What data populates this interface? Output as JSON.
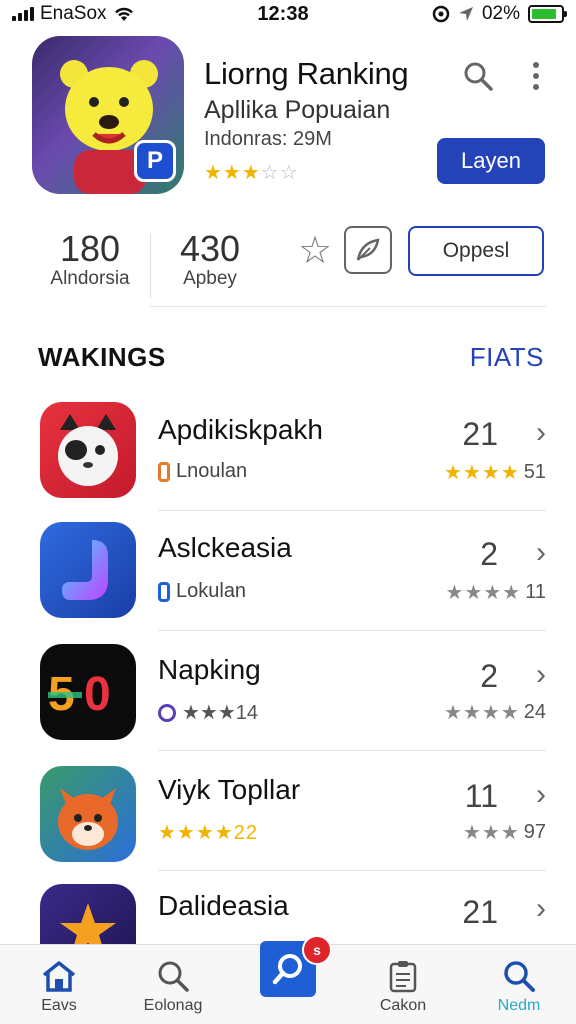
{
  "status_bar": {
    "carrier": "EnaSox",
    "time": "12:38",
    "battery": "02%",
    "battery_level": 0.85
  },
  "header": {
    "title": "Liorng Ranking",
    "subtitle": "Apllika Popuaian",
    "meta": "Indonras: 29M",
    "rating_stars": 3,
    "primary_button": "Layen"
  },
  "stats": [
    {
      "value": "180",
      "label": "Alndorsia"
    },
    {
      "value": "430",
      "label": "Apbey"
    }
  ],
  "actions": {
    "outline_button": "Oppesl"
  },
  "section": {
    "title": "WAKINGS",
    "link": "FIATS"
  },
  "items": [
    {
      "name": "Apdikiskpakh",
      "sub": "Lnoulan",
      "rank": "21",
      "stars": "★★★★",
      "rating": "51",
      "stars_color": "yellow"
    },
    {
      "name": "Aslckeasia",
      "sub": "Lokulan",
      "rank": "2",
      "stars": "★★★★",
      "rating": "11",
      "stars_color": "gray"
    },
    {
      "name": "Napking",
      "sub": "★★★14",
      "rank": "2",
      "stars": "★★★★",
      "rating": "24",
      "stars_color": "gray"
    },
    {
      "name": "Viyk Topllar",
      "sub": "★★★★22",
      "rank": "11",
      "stars": "★★★",
      "rating": "97",
      "stars_color": "gray"
    },
    {
      "name": "Dalideasia",
      "sub": "",
      "rank": "21",
      "stars": "",
      "rating": "",
      "stars_color": "yellow"
    }
  ],
  "tabs": [
    {
      "label": "Eavs",
      "icon": "home-icon"
    },
    {
      "label": "Eolonag",
      "icon": "search-icon"
    },
    {
      "label": "",
      "icon": "search-icon",
      "badge": "s"
    },
    {
      "label": "Cakon",
      "icon": "clipboard-icon"
    },
    {
      "label": "Nedm",
      "icon": "search-icon"
    }
  ],
  "colors": {
    "accent": "#2443b8",
    "star": "#f0b400",
    "badge": "#e0242b"
  }
}
